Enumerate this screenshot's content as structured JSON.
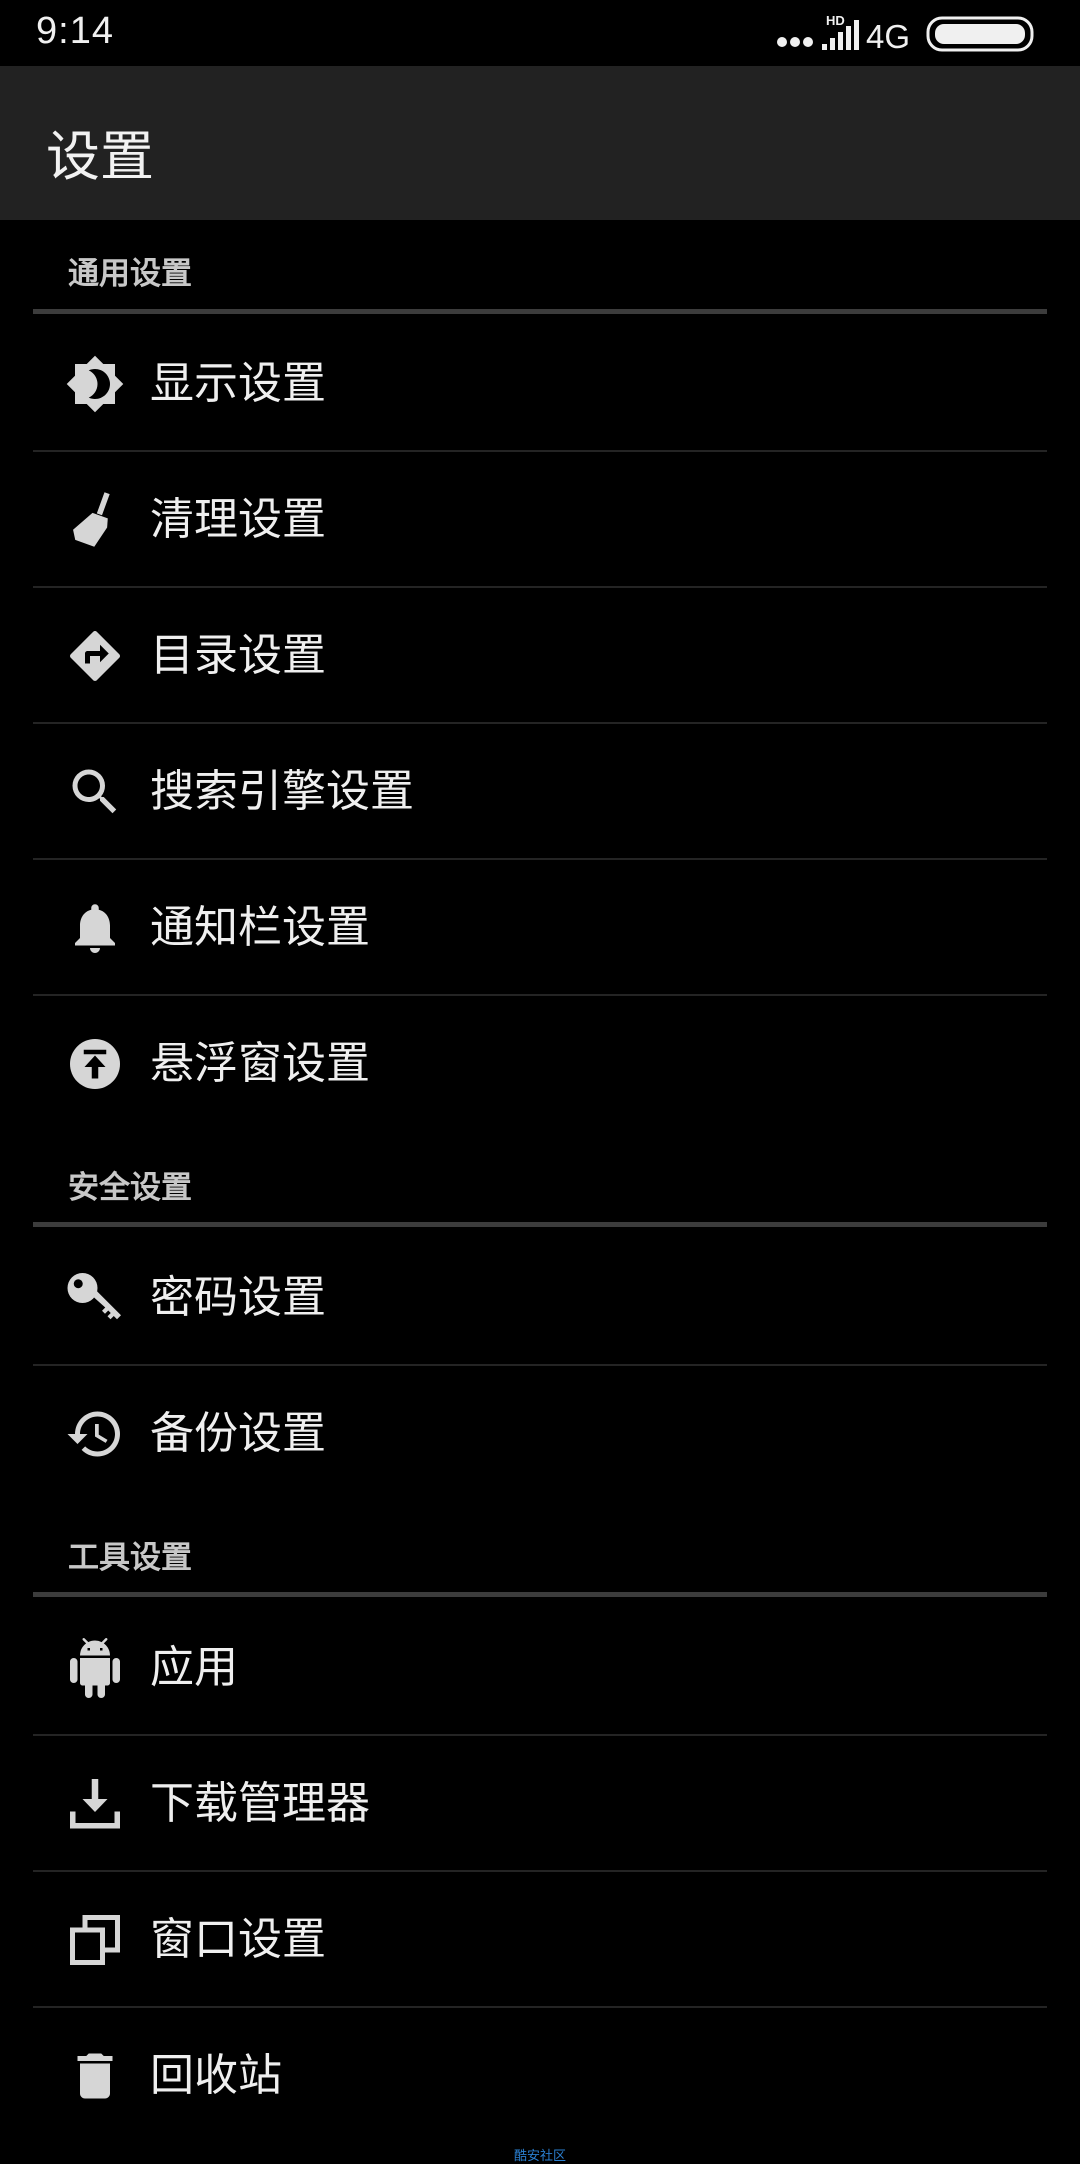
{
  "status_bar": {
    "time": "9:14",
    "network": "4G",
    "hd_badge": "HD",
    "signal_icon": "signal-bars-icon",
    "battery_icon": "battery-icon",
    "dots_icon": "more-dots-icon"
  },
  "app_bar": {
    "title": "设置"
  },
  "sections": {
    "general": {
      "title": "通用设置",
      "items": [
        {
          "label": "显示设置",
          "icon": "brightness-icon"
        },
        {
          "label": "清理设置",
          "icon": "broom-icon"
        },
        {
          "label": "目录设置",
          "icon": "directions-icon"
        },
        {
          "label": "搜索引擎设置",
          "icon": "search-icon"
        },
        {
          "label": "通知栏设置",
          "icon": "bell-icon"
        },
        {
          "label": "悬浮窗设置",
          "icon": "upload-circle-icon"
        }
      ]
    },
    "security": {
      "title": "安全设置",
      "items": [
        {
          "label": "密码设置",
          "icon": "key-icon"
        },
        {
          "label": "备份设置",
          "icon": "history-icon"
        }
      ]
    },
    "tools": {
      "title": "工具设置",
      "items": [
        {
          "label": "应用",
          "icon": "android-icon"
        },
        {
          "label": "下载管理器",
          "icon": "download-icon"
        },
        {
          "label": "窗口设置",
          "icon": "windows-copy-icon"
        },
        {
          "label": "回收站",
          "icon": "trash-icon"
        }
      ]
    }
  },
  "watermark": "酷安社区",
  "colors": {
    "background": "#000000",
    "app_bar": "#222222",
    "text": "#efefef",
    "section_text": "#c8c8c8",
    "icon": "#d6d6d6",
    "watermark": "#2a7fd0"
  }
}
